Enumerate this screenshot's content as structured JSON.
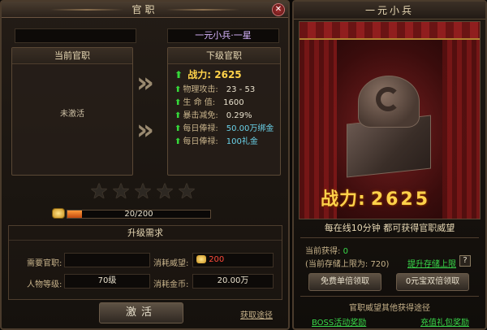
{
  "left": {
    "title": "官职",
    "close_glyph": "✕",
    "current_name": "",
    "next_name": "一元小兵·一星",
    "current": {
      "header": "当前官职",
      "status": "未激活"
    },
    "next": {
      "header": "下级官职",
      "power_label": "战力:",
      "power_value": "2625",
      "stats": [
        {
          "label": "物理攻击:",
          "value": "23 - 53",
          "color": "normal"
        },
        {
          "label": "生 命 值:",
          "value": "1600",
          "color": "normal"
        },
        {
          "label": "暴击减免:",
          "value": "0.29%",
          "color": "normal"
        },
        {
          "label": "每日俸禄:",
          "value": "50.00万绑金",
          "color": "blue"
        },
        {
          "label": "每日俸禄:",
          "value": "100礼金",
          "color": "blue"
        }
      ]
    },
    "stars": {
      "filled": 0,
      "total": 5
    },
    "progress": {
      "text": "20/200",
      "current": 20,
      "max": 200
    },
    "requirements": {
      "header": "升级需求",
      "rows": [
        {
          "left_label": "需要官职:",
          "left_value": "",
          "right_label": "消耗威望:",
          "right_value": "200"
        },
        {
          "left_label": "人物等级:",
          "left_value": "70级",
          "right_label": "消耗金币:",
          "right_value": "20.00万"
        }
      ]
    },
    "activate_button": "激活",
    "get_path_link": "获取途径"
  },
  "right": {
    "title": "一元小兵",
    "power_label": "战力:",
    "power_value": "2625",
    "info": "每在线10分钟 都可获得官职威望",
    "current_gain_label": "当前获得:",
    "current_gain_value": "0",
    "limit_text": "(当前存储上限为: 720)",
    "raise_limit_link": "提升存储上限",
    "help_glyph": "?",
    "free_claim_button": "免费单倍领取",
    "paid_claim_button": "0元宝双倍领取",
    "other_ways_header": "官职威望其他获得途径",
    "boss_link": "BOSS活动奖励",
    "recharge_link": "充值礼包奖励"
  },
  "colors": {
    "accent_gold": "#ffd24a",
    "stat_green": "#36d93a",
    "link_green": "#39d94a",
    "next_name_purple": "#d9b6ff",
    "prestige_red": "#ff4a3a",
    "progress_orange": "#ff9a3a"
  },
  "icons": [
    "close-icon",
    "arrow-up-icon",
    "double-chevron-right-icon",
    "star-icon",
    "gold-ingot-icon",
    "seal-icon",
    "help-icon"
  ]
}
